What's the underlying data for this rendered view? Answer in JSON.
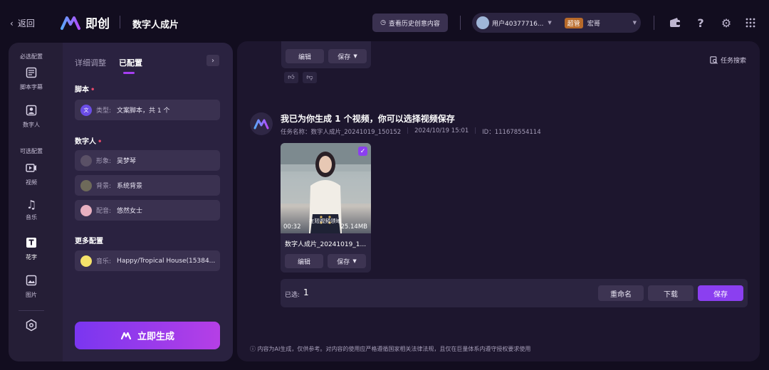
{
  "header": {
    "back_label": "返回",
    "logo_text": "即创",
    "page_title": "数字人成片",
    "history_button": "查看历史创意内容",
    "user_name": "用户40377716...",
    "user_badge": "超管",
    "user_alias": "宏哥"
  },
  "sidebar": {
    "required_section": "必选配置",
    "optional_section": "可选配置",
    "items": [
      {
        "label": "脚本字幕",
        "icon": "script-subtitle-icon"
      },
      {
        "label": "数字人",
        "icon": "digital-human-icon"
      },
      {
        "label": "视频",
        "icon": "video-icon"
      },
      {
        "label": "音乐",
        "icon": "music-icon"
      },
      {
        "label": "花字",
        "icon": "text-effect-icon"
      },
      {
        "label": "图片",
        "icon": "image-icon"
      }
    ],
    "active_item": "花字"
  },
  "config_panel": {
    "tabs": [
      "详细调整",
      "已配置"
    ],
    "active_tab": "已配置",
    "script_section": "脚本",
    "script_key": "类型:",
    "script_value": "文案脚本，共 1 个",
    "human_section": "数字人",
    "avatar_key": "形象:",
    "avatar_value": "吴梦琴",
    "background_key": "背景:",
    "background_value": "系统背景",
    "voice_key": "配音:",
    "voice_value": "悠然女士",
    "more_section": "更多配置",
    "music_key": "音乐:",
    "music_value": "Happy/Tropical House(15384...",
    "generate_button": "立即生成"
  },
  "main": {
    "top_card": {
      "edit_label": "编辑",
      "save_label": "保存"
    },
    "task_search": "任务搜索",
    "message_title": "我已为你生成 1 个视频，你可以选择视频保存",
    "task_name": "任务名称：数字人成片_20241019_150152",
    "task_time": "2024/10/19 15:01",
    "task_id": "ID：111678554114",
    "video": {
      "duration": "00:32",
      "size": "25.14MB",
      "caption": "在短视频领域",
      "name": "数字人成片_20241019_1...",
      "edit_label": "编辑",
      "save_label": "保存"
    },
    "selection": {
      "label": "已选:",
      "count": "1",
      "rename_button": "重命名",
      "download_button": "下载",
      "save_button": "保存"
    },
    "disclaimer": "内容为AI生成，仅供参考。对内容的使用应严格遵循国家相关法律法规，且仅在巨量体系内遵守授权要求使用"
  },
  "colors": {
    "accent": "#8b3ff0",
    "background": "#120d1f",
    "panel": "#2a2240"
  }
}
